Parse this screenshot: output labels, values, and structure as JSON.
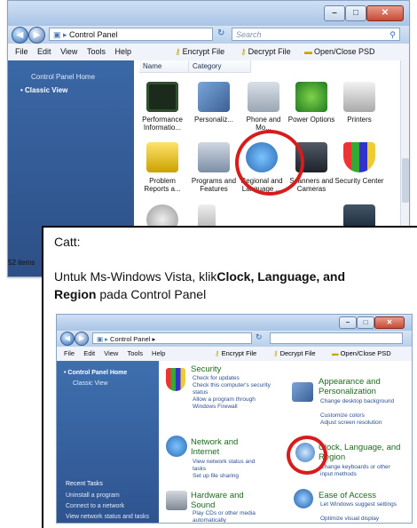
{
  "top_window": {
    "address": "Control Panel",
    "search_placeholder": "Search",
    "menu": [
      "File",
      "Edit",
      "View",
      "Tools",
      "Help"
    ],
    "toolbar": [
      "Encrypt File",
      "Decrypt File",
      "Open/Close PSD"
    ],
    "nav": {
      "home": "Control Panel Home",
      "current": "Classic View"
    },
    "columns": [
      "Name",
      "Category"
    ],
    "items_row1": [
      "Performance Informatio...",
      "Personaliz...",
      "Phone and Mo...",
      "Power Options",
      "Printers"
    ],
    "items_row2": [
      "Problem Reports a...",
      "Programs and Features",
      "Regional and Language ...",
      "Scanners and Cameras",
      "Security Center"
    ],
    "status": "52 items"
  },
  "panel": {
    "catt": "Catt:",
    "line1": "Untuk Ms-Windows Vista, klik",
    "line1_bold": "Clock, Language, and",
    "line2_bold": "Region",
    "line2": " pada Control Panel"
  },
  "bottom_window": {
    "address": "Control Panel ▸",
    "menu": [
      "File",
      "Edit",
      "View",
      "Tools",
      "Help"
    ],
    "toolbar": [
      "Encrypt File",
      "Decrypt File",
      "Open/Close PSD"
    ],
    "nav": {
      "home": "Control Panel Home",
      "classic": "Classic View"
    },
    "recent": {
      "title": "Recent Tasks",
      "items": [
        "Uninstall a program",
        "Connect to a network",
        "View network status and tasks"
      ]
    },
    "categories": [
      {
        "title": "Security",
        "links": [
          "Check for updates",
          "Check this computer's security status",
          "Allow a program through Windows Firewall"
        ]
      },
      {
        "title": "Appearance and Personalization",
        "links": [
          "Change desktop background",
          "Customize colors",
          "Adjust screen resolution"
        ]
      },
      {
        "title": "Network and Internet",
        "links": [
          "View network status and tasks",
          "Set up file sharing"
        ]
      },
      {
        "title": "Clock, Language, and Region",
        "links": [
          "Change keyboards or other input methods"
        ]
      },
      {
        "title": "Hardware and Sound",
        "links": [
          "Play CDs or other media automatically"
        ]
      },
      {
        "title": "Ease of Access",
        "links": [
          "Let Windows suggest settings",
          "Optimize visual display"
        ]
      }
    ]
  },
  "colors": {
    "nav_blue": "#2d4f86",
    "highlight_ring": "#d81b1b",
    "category_green": "#1c6a1c"
  }
}
